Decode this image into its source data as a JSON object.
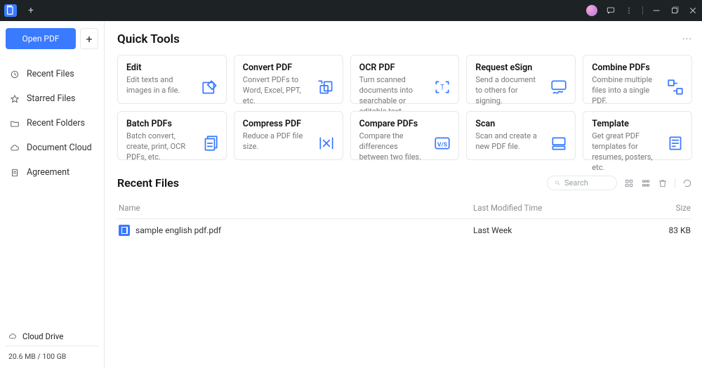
{
  "titlebar": {
    "new_tab_tooltip": "+"
  },
  "sidebar": {
    "open_label": "Open PDF",
    "new_label": "+",
    "items": [
      {
        "label": "Recent Files",
        "icon": "clock"
      },
      {
        "label": "Starred Files",
        "icon": "star"
      },
      {
        "label": "Recent Folders",
        "icon": "folder"
      },
      {
        "label": "Document Cloud",
        "icon": "cloud"
      },
      {
        "label": "Agreement",
        "icon": "doc"
      }
    ],
    "cloud_drive_label": "Cloud Drive",
    "storage_label": "20.6 MB / 100 GB"
  },
  "main": {
    "quick_tools_title": "Quick Tools",
    "more": "···",
    "tools": [
      {
        "title": "Edit",
        "desc": "Edit texts and images in a file."
      },
      {
        "title": "Convert PDF",
        "desc": "Convert PDFs to Word, Excel, PPT, etc."
      },
      {
        "title": "OCR PDF",
        "desc": "Turn scanned documents into searchable or editable text."
      },
      {
        "title": "Request eSign",
        "desc": "Send a document to others for signing."
      },
      {
        "title": "Combine PDFs",
        "desc": "Combine multiple files into a single PDF."
      },
      {
        "title": "Batch PDFs",
        "desc": "Batch convert, create, print, OCR PDFs, etc."
      },
      {
        "title": "Compress PDF",
        "desc": "Reduce a PDF file size."
      },
      {
        "title": "Compare PDFs",
        "desc": "Compare the differences between two files."
      },
      {
        "title": "Scan",
        "desc": "Scan and create a new PDF file."
      },
      {
        "title": "Template",
        "desc": "Get great PDF templates for resumes, posters, etc."
      }
    ],
    "recent_files_title": "Recent Files",
    "search_placeholder": "Search",
    "columns": {
      "name": "Name",
      "modified": "Last Modified Time",
      "size": "Size"
    },
    "files": [
      {
        "name": "sample english pdf.pdf",
        "modified": "Last Week",
        "size": "83 KB"
      }
    ]
  }
}
